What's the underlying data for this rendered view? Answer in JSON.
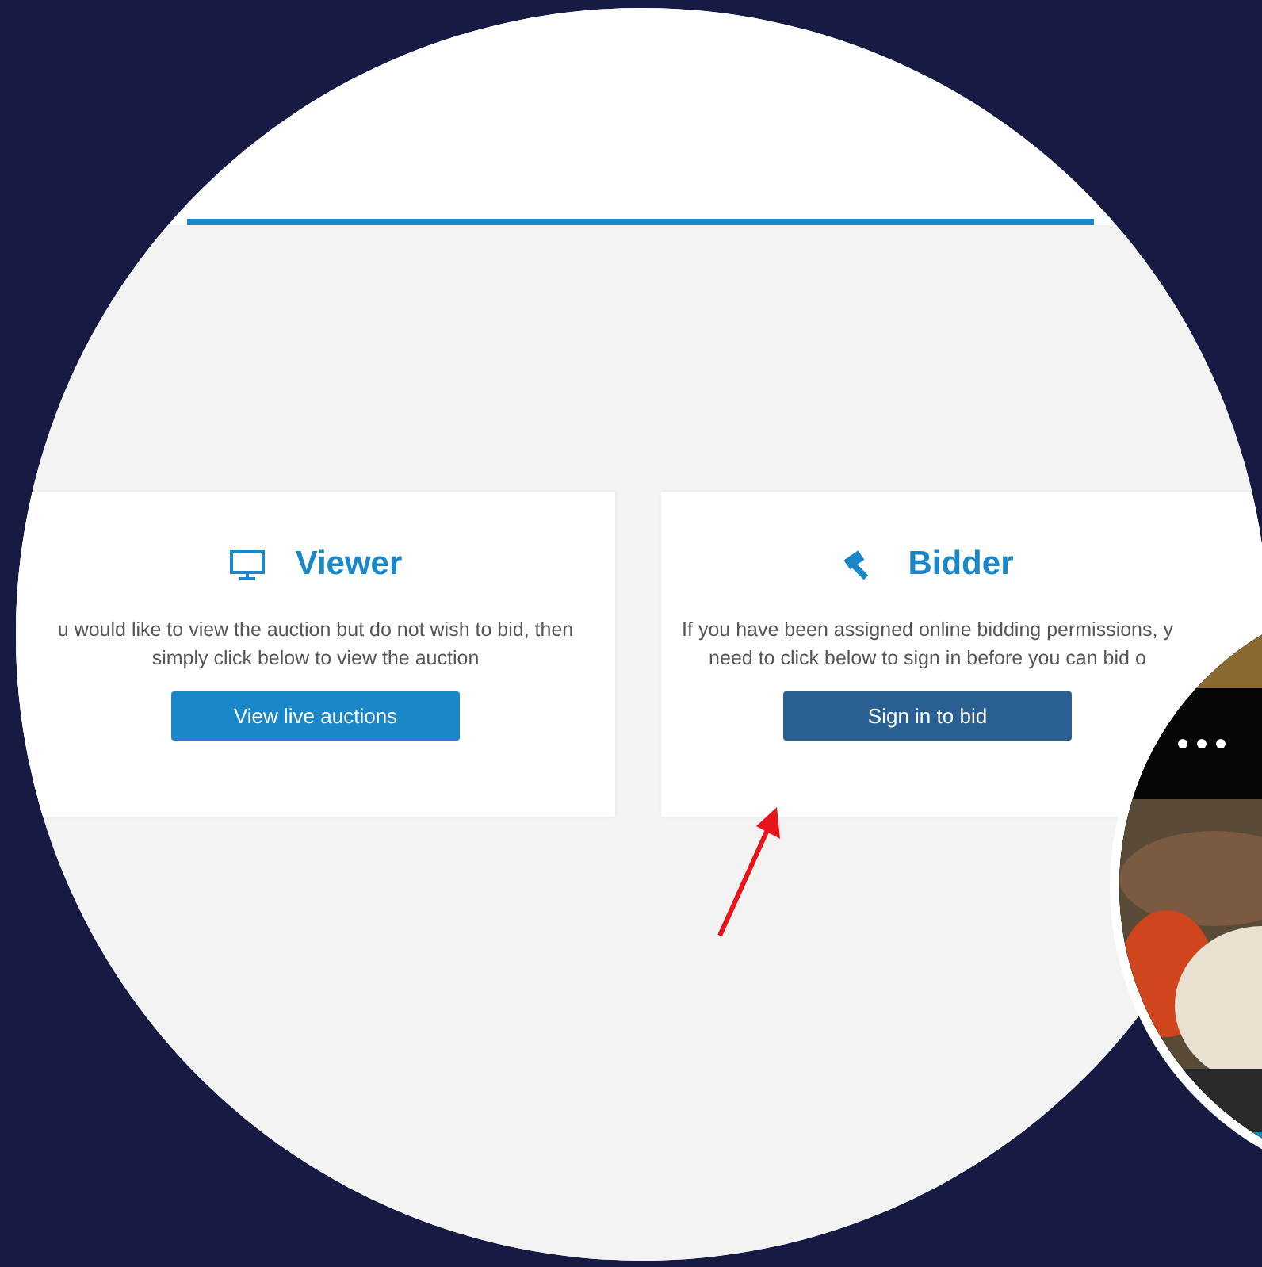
{
  "cards": [
    {
      "kind": "viewer",
      "title": "Viewer",
      "lines": [
        "u would like to view the auction but do not wish to bid, then",
        "simply click below to view the auction"
      ],
      "button": "View live auctions"
    },
    {
      "kind": "bidder",
      "title": "Bidder",
      "lines": [
        "If you have been assigned online bidding permissions, y",
        "need to click below to sign in before you can bid o"
      ],
      "button": "Sign in to bid"
    }
  ]
}
